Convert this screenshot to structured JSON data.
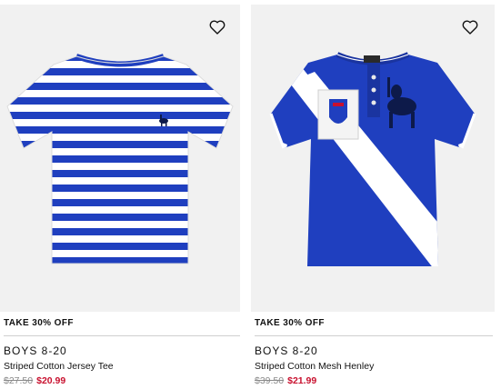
{
  "products": [
    {
      "promo": "TAKE 30% OFF",
      "category": "BOYS 8-20",
      "name": "Striped Cotton Jersey Tee",
      "original_price": "$27.50",
      "sale_price": "$20.99",
      "image_icon": "striped-tee-image",
      "wishlist_icon": "heart-icon"
    },
    {
      "promo": "TAKE 30% OFF",
      "category": "BOYS 8-20",
      "name": "Striped Cotton Mesh Henley",
      "original_price": "$39.50",
      "sale_price": "$21.99",
      "image_icon": "henley-shirt-image",
      "wishlist_icon": "heart-icon"
    }
  ],
  "colors": {
    "sale": "#c8102e",
    "strike": "#8a8a8a",
    "tile_bg": "#f1f1f1",
    "royal_blue": "#1f3fbf"
  }
}
